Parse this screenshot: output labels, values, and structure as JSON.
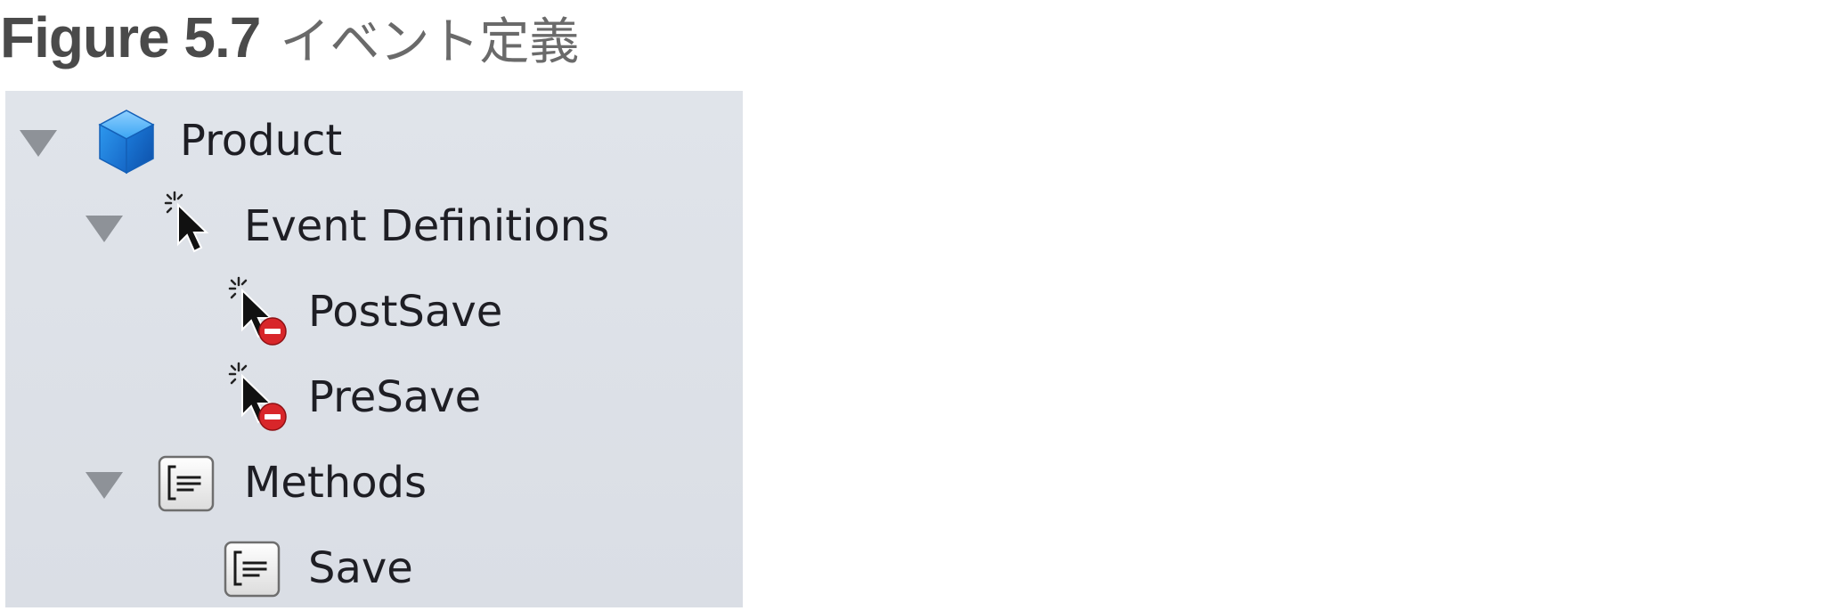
{
  "caption": {
    "label": "Figure 5.7",
    "title": "イベント定義"
  },
  "outline": {
    "rows": [
      {
        "label": "Product",
        "icon": "entity-cube-icon",
        "expanded": true
      },
      {
        "label": "Event Definitions",
        "icon": "event-cursor-icon",
        "expanded": true
      },
      {
        "label": "PostSave",
        "icon": "event-cursor-error-icon"
      },
      {
        "label": "PreSave",
        "icon": "event-cursor-error-icon"
      },
      {
        "label": "Methods",
        "icon": "method-document-icon",
        "expanded": true
      },
      {
        "label": "Save",
        "icon": "method-document-icon"
      }
    ],
    "colors": {
      "panel_background": "#dde1e8",
      "cube_blue": "#2a8fe8",
      "error_red": "#d8262a",
      "disclosure_gray": "#8e9298"
    }
  }
}
